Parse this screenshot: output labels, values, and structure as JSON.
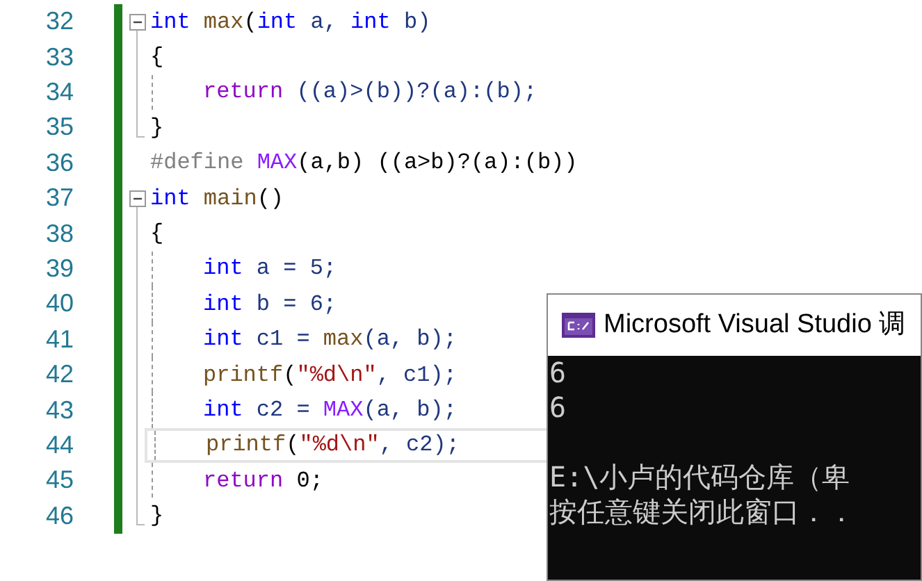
{
  "editor": {
    "lines": [
      {
        "number": "32",
        "changed": true,
        "indented": false,
        "fold": true,
        "block_end": false,
        "current": false,
        "tokens": [
          {
            "text": "int",
            "kind": "keyword"
          },
          {
            "text": " max",
            "kind": "function"
          },
          {
            "text": "(",
            "kind": "plain"
          },
          {
            "text": "int",
            "kind": "keyword"
          },
          {
            "text": " a, ",
            "kind": "ident"
          },
          {
            "text": "int",
            "kind": "keyword"
          },
          {
            "text": " b)",
            "kind": "ident"
          }
        ]
      },
      {
        "number": "33",
        "changed": true,
        "indented": false,
        "fold": false,
        "block_end": false,
        "current": false,
        "tokens": [
          {
            "text": "{",
            "kind": "plain"
          }
        ]
      },
      {
        "number": "34",
        "changed": true,
        "indented": true,
        "fold": false,
        "block_end": false,
        "current": false,
        "tokens": [
          {
            "text": "return",
            "kind": "control"
          },
          {
            "text": " ((a)>(b))?(a):(b);",
            "kind": "ident"
          }
        ]
      },
      {
        "number": "35",
        "changed": true,
        "indented": false,
        "fold": false,
        "block_end": true,
        "current": false,
        "tokens": [
          {
            "text": "}",
            "kind": "plain"
          }
        ]
      },
      {
        "number": "36",
        "changed": true,
        "indented": false,
        "fold": false,
        "block_end": false,
        "current": false,
        "tokens": [
          {
            "text": "#define",
            "kind": "preprocessor"
          },
          {
            "text": " MAX",
            "kind": "macro"
          },
          {
            "text": "(a,b) ((a>b)?(a):(b))",
            "kind": "plain"
          }
        ]
      },
      {
        "number": "37",
        "changed": true,
        "indented": false,
        "fold": true,
        "block_end": false,
        "current": false,
        "tokens": [
          {
            "text": "int",
            "kind": "keyword"
          },
          {
            "text": " main",
            "kind": "function"
          },
          {
            "text": "()",
            "kind": "plain"
          }
        ]
      },
      {
        "number": "38",
        "changed": true,
        "indented": false,
        "fold": false,
        "block_end": false,
        "current": false,
        "tokens": [
          {
            "text": "{",
            "kind": "plain"
          }
        ]
      },
      {
        "number": "39",
        "changed": true,
        "indented": true,
        "fold": false,
        "block_end": false,
        "current": false,
        "tokens": [
          {
            "text": "int",
            "kind": "keyword"
          },
          {
            "text": " a = 5;",
            "kind": "ident"
          }
        ]
      },
      {
        "number": "40",
        "changed": true,
        "indented": true,
        "fold": false,
        "block_end": false,
        "current": false,
        "tokens": [
          {
            "text": "int",
            "kind": "keyword"
          },
          {
            "text": " b = 6;",
            "kind": "ident"
          }
        ]
      },
      {
        "number": "41",
        "changed": true,
        "indented": true,
        "fold": false,
        "block_end": false,
        "current": false,
        "tokens": [
          {
            "text": "int",
            "kind": "keyword"
          },
          {
            "text": " c1 = ",
            "kind": "ident"
          },
          {
            "text": "max",
            "kind": "function"
          },
          {
            "text": "(a, b);",
            "kind": "ident"
          }
        ]
      },
      {
        "number": "42",
        "changed": true,
        "indented": true,
        "fold": false,
        "block_end": false,
        "current": false,
        "tokens": [
          {
            "text": "printf",
            "kind": "function"
          },
          {
            "text": "(",
            "kind": "plain"
          },
          {
            "text": "\"%d\\n\"",
            "kind": "string"
          },
          {
            "text": ", c1);",
            "kind": "ident"
          }
        ]
      },
      {
        "number": "43",
        "changed": true,
        "indented": true,
        "fold": false,
        "block_end": false,
        "current": false,
        "tokens": [
          {
            "text": "int",
            "kind": "keyword"
          },
          {
            "text": " c2 = ",
            "kind": "ident"
          },
          {
            "text": "MAX",
            "kind": "macro"
          },
          {
            "text": "(a, b);",
            "kind": "ident"
          }
        ]
      },
      {
        "number": "44",
        "changed": true,
        "indented": true,
        "fold": false,
        "block_end": false,
        "current": true,
        "tokens": [
          {
            "text": "printf",
            "kind": "function"
          },
          {
            "text": "(",
            "kind": "plain"
          },
          {
            "text": "\"%d\\n\"",
            "kind": "string"
          },
          {
            "text": ", c2);",
            "kind": "ident"
          }
        ]
      },
      {
        "number": "45",
        "changed": true,
        "indented": true,
        "fold": false,
        "block_end": false,
        "current": false,
        "tokens": [
          {
            "text": "return",
            "kind": "control"
          },
          {
            "text": " 0;",
            "kind": "plain"
          }
        ]
      },
      {
        "number": "46",
        "changed": true,
        "indented": false,
        "fold": false,
        "block_end": true,
        "current": false,
        "tokens": [
          {
            "text": "}",
            "kind": "plain"
          }
        ]
      }
    ]
  },
  "console": {
    "title": "Microsoft Visual Studio 调",
    "output_lines": [
      "6",
      "6"
    ],
    "message_lines": [
      "E:\\小卢的代码仓库（卑",
      "按任意键关闭此窗口．．"
    ]
  }
}
